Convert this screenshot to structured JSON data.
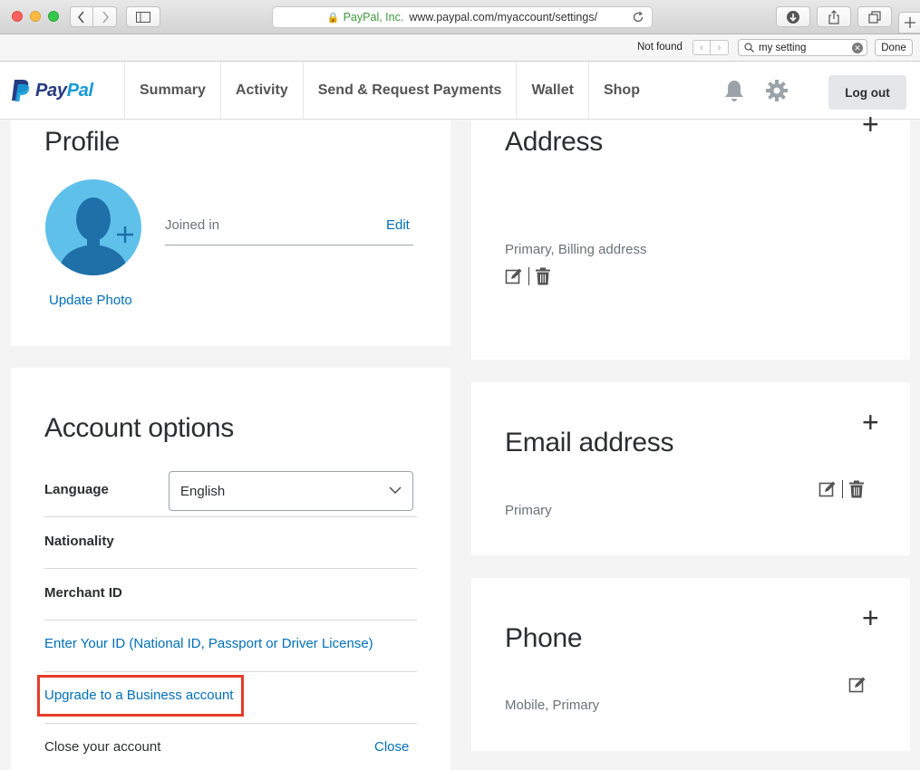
{
  "browser": {
    "org": "PayPal, Inc.",
    "url": "www.paypal.com/myaccount/settings/",
    "find": {
      "status": "Not found",
      "query": "my setting",
      "done_label": "Done"
    }
  },
  "header": {
    "logo_part1": "Pay",
    "logo_part2": "Pal",
    "nav": [
      "Summary",
      "Activity",
      "Send & Request Payments",
      "Wallet",
      "Shop"
    ],
    "logout_label": "Log out"
  },
  "profile": {
    "title": "Profile",
    "joined_label": "Joined in",
    "edit_label": "Edit",
    "update_photo_label": "Update Photo"
  },
  "address": {
    "title": "Address",
    "value": "Primary, Billing address"
  },
  "email": {
    "title": "Email address",
    "value": "Primary"
  },
  "phone": {
    "title": "Phone",
    "value": "Mobile, Primary"
  },
  "account_options": {
    "title": "Account options",
    "language_label": "Language",
    "language_value": "English",
    "nationality_label": "Nationality",
    "merchant_id_label": "Merchant ID",
    "enter_id_link": "Enter Your ID (National ID, Passport or Driver License)",
    "upgrade_link": "Upgrade to a Business account",
    "close_account_label": "Close your account",
    "close_link": "Close"
  },
  "colors": {
    "paypal_dark_blue": "#253b80",
    "paypal_light_blue": "#179bd7",
    "link": "#0070ba",
    "highlight": "#e53d2a"
  }
}
